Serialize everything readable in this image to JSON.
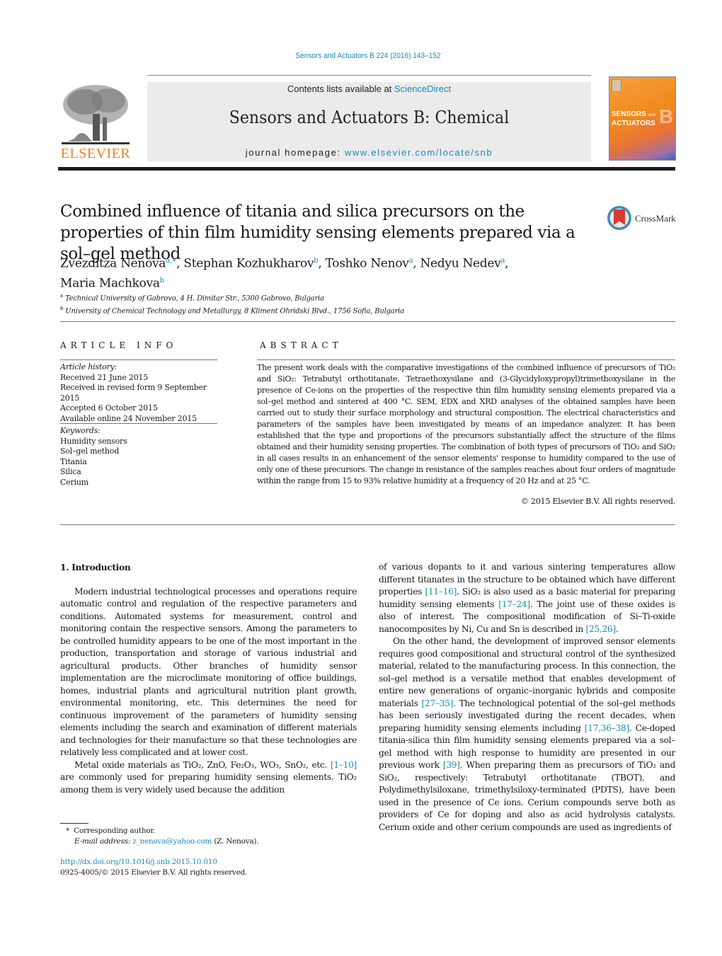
{
  "header": {
    "journal_ref": "Sensors and Actuators B 224 (2016) 143–152",
    "contents_prefix": "Contents lists available at ",
    "contents_link": "ScienceDirect",
    "journal_title": "Sensors and Actuators B: Chemical",
    "homepage_prefix": "journal homepage: ",
    "homepage_link": "www.elsevier.com/locate/snb",
    "publisher_logo_text": "ELSEVIER",
    "cover_title_line1": "SENSORS",
    "cover_title_and": "and",
    "cover_title_line2": "ACTUATORS",
    "cover_letter": "B",
    "crossmark_label": "CrossMark"
  },
  "article": {
    "title": "Combined influence of titania and silica precursors on the properties of thin film humidity sensing elements prepared via a sol–gel method",
    "authors": [
      {
        "name": "Zvezditza Nenova",
        "sup": "a,∗",
        "sep": ", "
      },
      {
        "name": "Stephan Kozhukharov",
        "sup": "b",
        "sep": ", "
      },
      {
        "name": "Toshko Nenov",
        "sup": "a",
        "sep": ", "
      },
      {
        "name": "Nedyu Nedev",
        "sup": "a",
        "sep": ","
      },
      {
        "name": "Maria Machkova",
        "sup": "b",
        "sep": ""
      }
    ],
    "affiliations": [
      {
        "mark": "a",
        "text": "Technical University of Gabrovo, 4 H. Dimitar Str., 5300 Gabrovo, Bulgaria"
      },
      {
        "mark": "b",
        "text": "University of Chemical Technology and Metallurgy, 8 Kliment Ohridski Blvd., 1756 Sofia, Bulgaria"
      }
    ]
  },
  "article_info": {
    "label": "ARTICLE INFO",
    "history_header": "Article history:",
    "history": [
      "Received 21 June 2015",
      "Received in revised form 9 September 2015",
      "Accepted 6 October 2015",
      "Available online 24 November 2015"
    ],
    "keywords_header": "Keywords:",
    "keywords": [
      "Humidity sensors",
      "Sol–gel method",
      "Titania",
      "Silica",
      "Cerium"
    ]
  },
  "abstract": {
    "label": "ABSTRACT",
    "text": "The present work deals with the comparative investigations of the combined influence of precursors of TiO₂ and SiO₂: Tetrabutyl orthotitanate, Tetraethoxysilane and (3-Glycidyloxypropyl)trimethoxysilane in the presence of Ce-ions on the properties of the respective thin film humidity sensing elements prepared via a sol–gel method and sintered at 400 °C. SEM, EDX and XRD analyses of the obtained samples have been carried out to study their surface morphology and structural composition. The electrical characteristics and parameters of the samples have been investigated by means of an impedance analyzer. It has been established that the type and proportions of the precursors substantially affect the structure of the films obtained and their humidity sensing properties. The combination of both types of precursors of TiO₂ and SiO₂ in all cases results in an enhancement of the sensor elements' response to humidity compared to the use of only one of these precursors. The change in resistance of the samples reaches about four orders of magnitude within the range from 15 to 93% relative humidity at a frequency of 20 Hz and at 25 °C.",
    "copyright": "© 2015 Elsevier B.V. All rights reserved."
  },
  "body": {
    "section_heading": "1.  Introduction",
    "left_paragraphs": [
      {
        "segments": [
          {
            "t": "Modern industrial technological processes and operations require automatic control and regulation of the respective parameters and conditions. Automated systems for measurement, control and monitoring contain the respective sensors. Among the parameters to be controlled humidity appears to be one of the most important in the production, transportation and storage of various industrial and agricultural products. Other branches of humidity sensor implementation are the microclimate monitoring of office buildings, homes, industrial plants and agricultural nutrition plant growth, environmental monitoring, etc. This determines the need for continuous improvement of the parameters of humidity sensing elements including the search and examination of different materials and technologies for their manufacture so that these technologies are relatively less complicated and at lower cost."
          }
        ]
      },
      {
        "segments": [
          {
            "t": "Metal oxide materials as TiO₂, ZnO, Fe₂O₃, WO₃, SnO₂, etc. "
          },
          {
            "t": "[1–10]",
            "ref": true
          },
          {
            "t": " are commonly used for preparing humidity sensing elements. TiO₂ among them is very widely used because the addition"
          }
        ]
      }
    ],
    "right_paragraphs": [
      {
        "noindent": true,
        "segments": [
          {
            "t": "of various dopants to it and various sintering temperatures allow different titanates in the structure to be obtained which have different properties "
          },
          {
            "t": "[11–16]",
            "ref": true
          },
          {
            "t": ". SiO₂ is also used as a basic material for preparing humidity sensing elements "
          },
          {
            "t": "[17–24]",
            "ref": true
          },
          {
            "t": ". The joint use of these oxides is also of interest. The compositional modification of Si–Ti-oxide nanocomposites by Ni, Cu and Sn is described in "
          },
          {
            "t": "[25,26]",
            "ref": true
          },
          {
            "t": "."
          }
        ]
      },
      {
        "segments": [
          {
            "t": "On the other hand, the development of improved sensor elements requires good compositional and structural control of the synthesized material, related to the manufacturing process. In this connection, the sol–gel method is a versatile method that enables development of entire new generations of organic–inorganic hybrids and composite materials "
          },
          {
            "t": "[27–35]",
            "ref": true
          },
          {
            "t": ". The technological potential of the sol–gel methods has been seriously investigated during the recent decades, when preparing humidity sensing elements including "
          },
          {
            "t": "[17,36–38]",
            "ref": true
          },
          {
            "t": ". Ce-doped titania-silica thin film humidity sensing elements prepared via a sol–gel method with high response to humidity are presented in our previous work "
          },
          {
            "t": "[39]",
            "ref": true
          },
          {
            "t": ". When preparing them as precursors of TiO₂ and SiO₂, respectively: Tetrabutyl orthotitanate (TBOT), and Polydimethylsiloxane, trimethylsiloxy-terminated (PDTS), have been used in the presence of Ce ions. Cerium compounds serve both as providers of Ce for doping and also as acid hydrolysis catalysts. Cerium oxide and other cerium compounds are used as ingredients of"
          }
        ]
      }
    ]
  },
  "footnotes": {
    "corresponding_mark": "*",
    "corresponding_text": "Corresponding author.",
    "email_label": "E-mail address:",
    "email": "z_nenova@yahoo.com",
    "email_suffix": " (Z. Nenova).",
    "doi": "http://dx.doi.org/10.1016/j.snb.2015.10.010",
    "issn_line": "0925-4005/© 2015 Elsevier B.V. All rights reserved."
  },
  "colors": {
    "link": "#1a8bb8",
    "elsevier_orange": "#f07f1f",
    "header_box": "#ebebeb"
  }
}
